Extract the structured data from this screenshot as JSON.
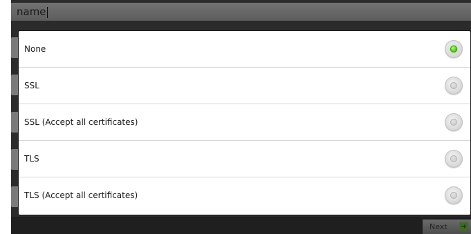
{
  "background_form": {
    "top_field_value": "name",
    "next_label": "Next"
  },
  "dialog": {
    "options": [
      {
        "label": "None",
        "checked": true
      },
      {
        "label": "SSL",
        "checked": false
      },
      {
        "label": "SSL (Accept all certificates)",
        "checked": false
      },
      {
        "label": "TLS",
        "checked": false
      },
      {
        "label": "TLS (Accept all certificates)",
        "checked": false
      }
    ]
  },
  "colors": {
    "radio_selected": "#4fc21a",
    "divider": "#d6d6d6"
  }
}
